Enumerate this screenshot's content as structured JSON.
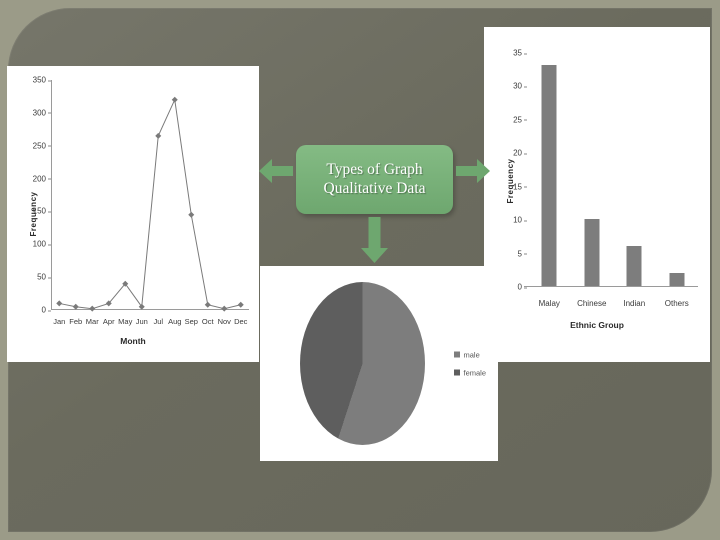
{
  "slide": {
    "background_color": "#6b6b5e",
    "border_color": "#9b9b88"
  },
  "callout": {
    "line1": "Types of Graph",
    "line2": "Qualitative Data",
    "fill_color": "#76b077",
    "text_color": "#ffffff"
  },
  "arrows": {
    "left_label": "arrow-to-line-chart",
    "right_label": "arrow-to-bar-chart",
    "down_label": "arrow-to-pie-chart",
    "color": "#6ea76f"
  },
  "chart_data": [
    {
      "type": "line",
      "id": "line-chart",
      "title": "",
      "xlabel": "Month",
      "ylabel": "Frequency",
      "categories": [
        "Jan",
        "Feb",
        "Mar",
        "Apr",
        "May",
        "Jun",
        "Jul",
        "Aug",
        "Sep",
        "Oct",
        "Nov",
        "Dec"
      ],
      "values": [
        10,
        5,
        2,
        10,
        40,
        5,
        265,
        320,
        145,
        8,
        2,
        8
      ],
      "yticks": [
        0,
        50,
        100,
        150,
        200,
        250,
        300,
        350
      ],
      "ylim": [
        0,
        350
      ],
      "grid": false,
      "legend": "none",
      "series_color": "#7a7a7a"
    },
    {
      "type": "bar",
      "id": "bar-chart",
      "title": "",
      "xlabel": "Ethnic Group",
      "ylabel": "Frequency",
      "categories": [
        "Malay",
        "Chinese",
        "Indian",
        "Others"
      ],
      "values": [
        33,
        10,
        6,
        2
      ],
      "yticks": [
        0,
        5,
        10,
        15,
        20,
        25,
        30,
        35
      ],
      "ylim": [
        0,
        35
      ],
      "grid": false,
      "legend": "none",
      "bar_color": "#7d7d7d"
    },
    {
      "type": "pie",
      "id": "pie-chart",
      "title": "",
      "labels": [
        "male",
        "female"
      ],
      "values": [
        55,
        45
      ],
      "colors": [
        "#7d7d7d",
        "#5e5e5e"
      ],
      "legend": "right"
    }
  ]
}
